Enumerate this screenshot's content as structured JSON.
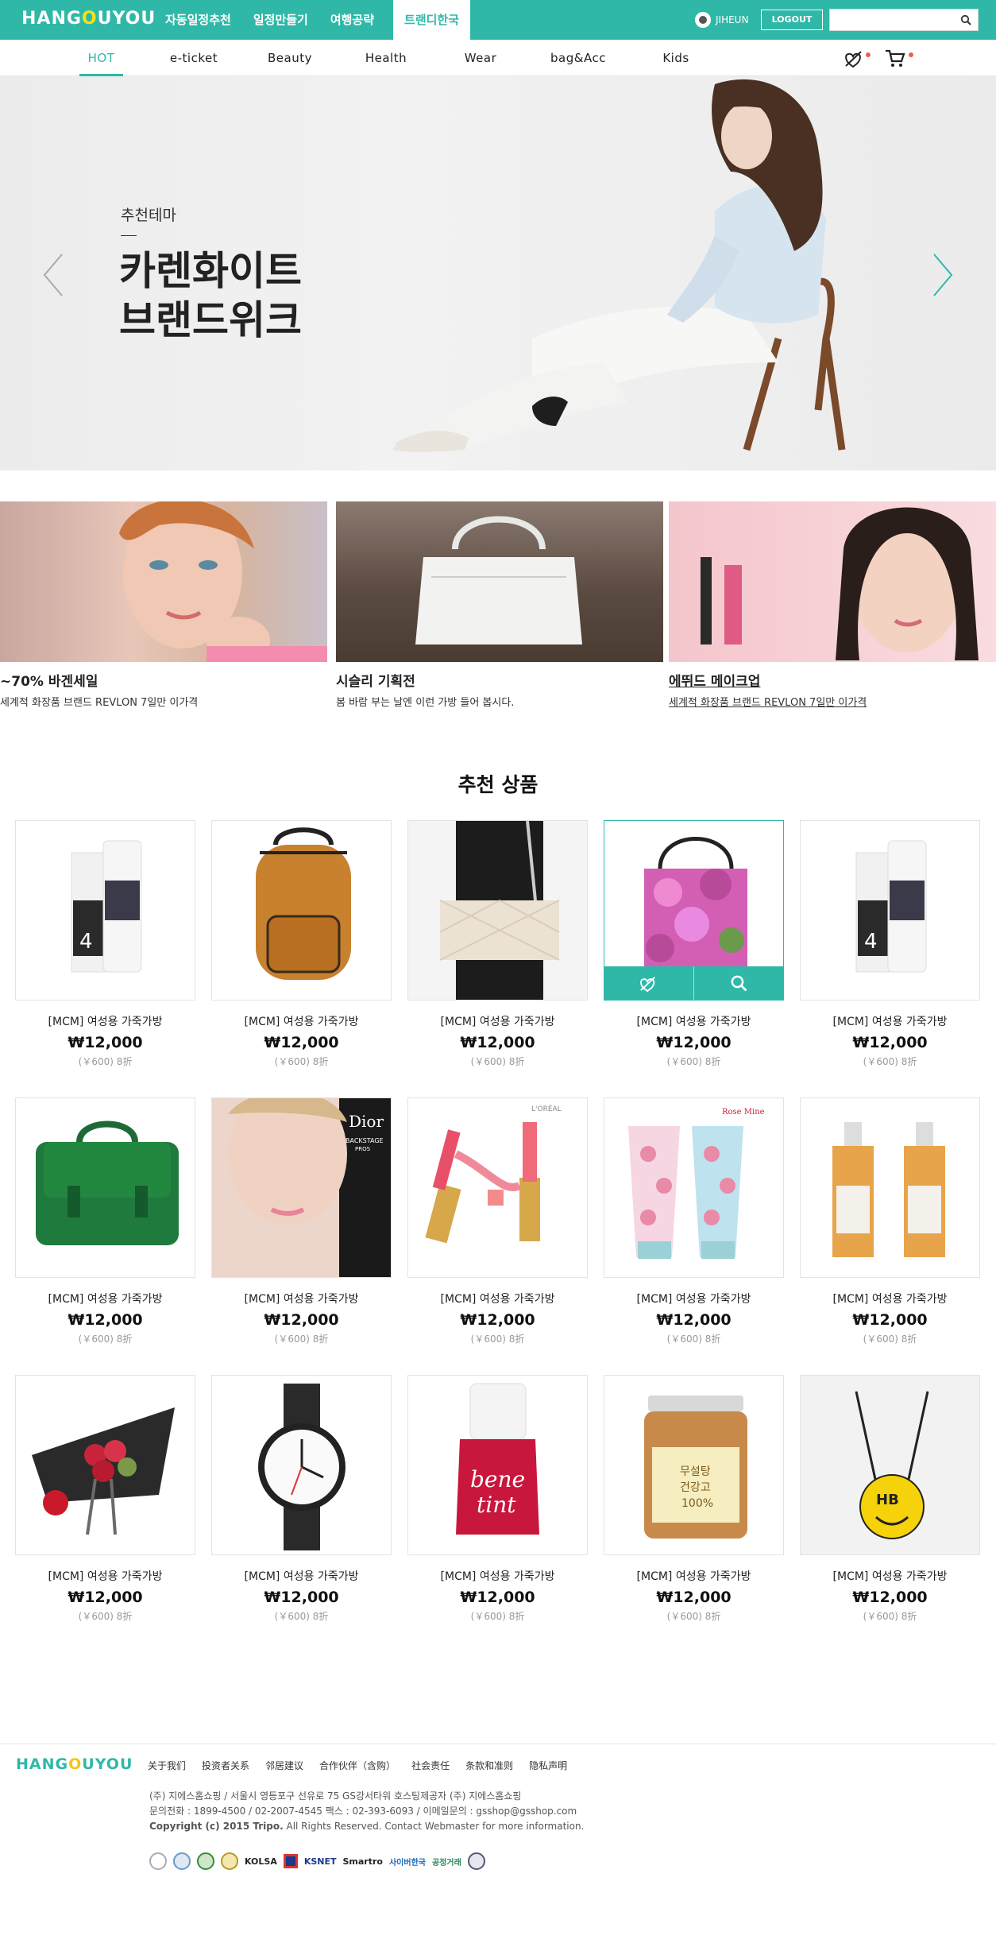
{
  "header": {
    "logo_parts": [
      "HANG",
      "O",
      "U",
      "Y",
      "O",
      "U"
    ],
    "nav": [
      "자동일정추천",
      "일정만들기",
      "여행공략",
      "트랜디한국"
    ],
    "nav_active_index": 3,
    "username": "JIHEUN",
    "logout": "LOGOUT",
    "search_placeholder": "",
    "brand_color": "#2fb8a8"
  },
  "subnav": {
    "tabs": [
      "HOT",
      "e-ticket",
      "Beauty",
      "Health",
      "Wear",
      "bag&Acc",
      "Kids"
    ],
    "active_index": 0
  },
  "hero": {
    "subtitle": "추천테마",
    "title": "카렌화이트\n브랜드위크",
    "slide_count": 6,
    "active_slide": 0
  },
  "promos": [
    {
      "title": "~70% 바겐세일",
      "desc": "세계적 화장품 브랜드 REVLON 7일만 이가격"
    },
    {
      "title": "시슬리 기획전",
      "desc": "봄 바람 부는 날엔 이런 가방 들어 봅시다."
    },
    {
      "title": "에뛰드 메이크업",
      "desc": "세계적 화장품 브랜드 REVLON 7일만 이가격"
    }
  ],
  "products_title": "추천 상품",
  "products": [
    {
      "name": "[MCM] 여성용 가죽가방",
      "price": "₩12,000",
      "sub": "(￥600) 8折",
      "image": "lotion-bottles"
    },
    {
      "name": "[MCM] 여성용 가죽가방",
      "price": "₩12,000",
      "sub": "(￥600) 8折",
      "image": "studded-backpack"
    },
    {
      "name": "[MCM] 여성용 가죽가방",
      "price": "₩12,000",
      "sub": "(￥600) 8折",
      "image": "quilted-shoulder-bag"
    },
    {
      "name": "[MCM] 여성용 가죽가방",
      "price": "₩12,000",
      "sub": "(￥600) 8折",
      "image": "floral-tote-bag",
      "highlighted": true
    },
    {
      "name": "[MCM] 여성용 가죽가방",
      "price": "₩12,000",
      "sub": "(￥600) 8折",
      "image": "lotion-bottles"
    },
    {
      "name": "[MCM] 여성용 가죽가방",
      "price": "₩12,000",
      "sub": "(￥600) 8折",
      "image": "green-satchel"
    },
    {
      "name": "[MCM] 여성용 가죽가방",
      "price": "₩12,000",
      "sub": "(￥600) 8折",
      "image": "dior-lipstick-model",
      "image_text": [
        "Dior",
        "BACKSTAGE",
        "PROS"
      ]
    },
    {
      "name": "[MCM] 여성용 가죽가방",
      "price": "₩12,000",
      "sub": "(￥600) 8折",
      "image": "loreal-lip-gloss",
      "image_text": [
        "L'ORÉAL"
      ]
    },
    {
      "name": "[MCM] 여성용 가죽가방",
      "price": "₩12,000",
      "sub": "(￥600) 8折",
      "image": "floral-tubes",
      "image_text": [
        "Rose Mine"
      ]
    },
    {
      "name": "[MCM] 여성용 가죽가방",
      "price": "₩12,000",
      "sub": "(￥600) 8折",
      "image": "juice-bottles"
    },
    {
      "name": "[MCM] 여성용 가죽가방",
      "price": "₩12,000",
      "sub": "(￥600) 8折",
      "image": "flower-bouquet"
    },
    {
      "name": "[MCM] 여성용 가죽가방",
      "price": "₩12,000",
      "sub": "(￥600) 8折",
      "image": "wrist-watch"
    },
    {
      "name": "[MCM] 여성용 가죽가방",
      "price": "₩12,000",
      "sub": "(￥600) 8折",
      "image": "benetint-bottle",
      "image_text": [
        "bene",
        "tint"
      ]
    },
    {
      "name": "[MCM] 여성용 가죽가방",
      "price": "₩12,000",
      "sub": "(￥600) 8折",
      "image": "snack-jar",
      "image_text": [
        "무설탕",
        "건강고",
        "100%"
      ]
    },
    {
      "name": "[MCM] 여성용 가죽가방",
      "price": "₩12,000",
      "sub": "(￥600) 8折",
      "image": "smiley-bag",
      "image_text": [
        "HB"
      ]
    }
  ],
  "footer": {
    "links": [
      "关于我们",
      "投资者关系",
      "邻居建议",
      "合作伙伴（含购）",
      "社会责任",
      "条款和准则",
      "隐私声明"
    ],
    "address": "(주) 지에스홈쇼핑  / 서울시 영등포구 선유로 75 GS강서타워 호스팅제공자 (주) 지에스홈쇼핑",
    "contact": "문의전화 : 1899-4500 / 02-2007-4545 팩스 : 02-393-6093 / 이메일문의 : gsshop@gsshop.com",
    "copyright_bold": "Copyright (c) 2015 Tripo.",
    "copyright_rest": " All Rights Reserved. Contact Webmaster for more information.",
    "badges": [
      "ccm",
      "seal-1",
      "seal-2",
      "seal-3",
      "KOLSA",
      "seal-4",
      "KSNET",
      "Smartro",
      "사이버한국",
      "공정거래",
      "seal-5"
    ]
  }
}
